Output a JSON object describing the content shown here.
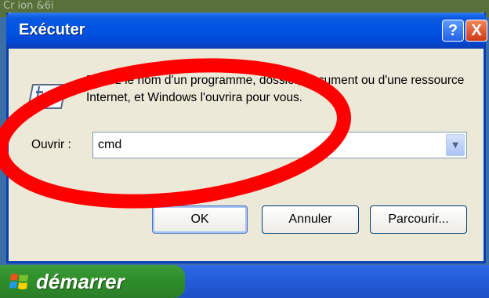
{
  "desktop": {
    "top_text": "Cr ion &6i"
  },
  "dialog": {
    "title": "Exécuter",
    "help_button": "?",
    "close_button": "X",
    "description": "Entrez le nom d'un programme, dossier, document ou d'une ressource Internet, et Windows l'ouvrira pour vous.",
    "open_label": "Ouvrir :",
    "open_value": "cmd",
    "buttons": {
      "ok": "OK",
      "cancel": "Annuler",
      "browse": "Parcourir..."
    }
  },
  "taskbar": {
    "start_label": "démarrer"
  },
  "icons": {
    "run": "run-dialog-icon",
    "dropdown": "chevron-down-icon",
    "start": "windows-logo-icon"
  },
  "colors": {
    "titlebar": "#0054e3",
    "annotation": "#ff0000",
    "dialog_bg": "#ece9d8",
    "start_button": "#2f8f2a",
    "taskbar": "#245edb"
  }
}
